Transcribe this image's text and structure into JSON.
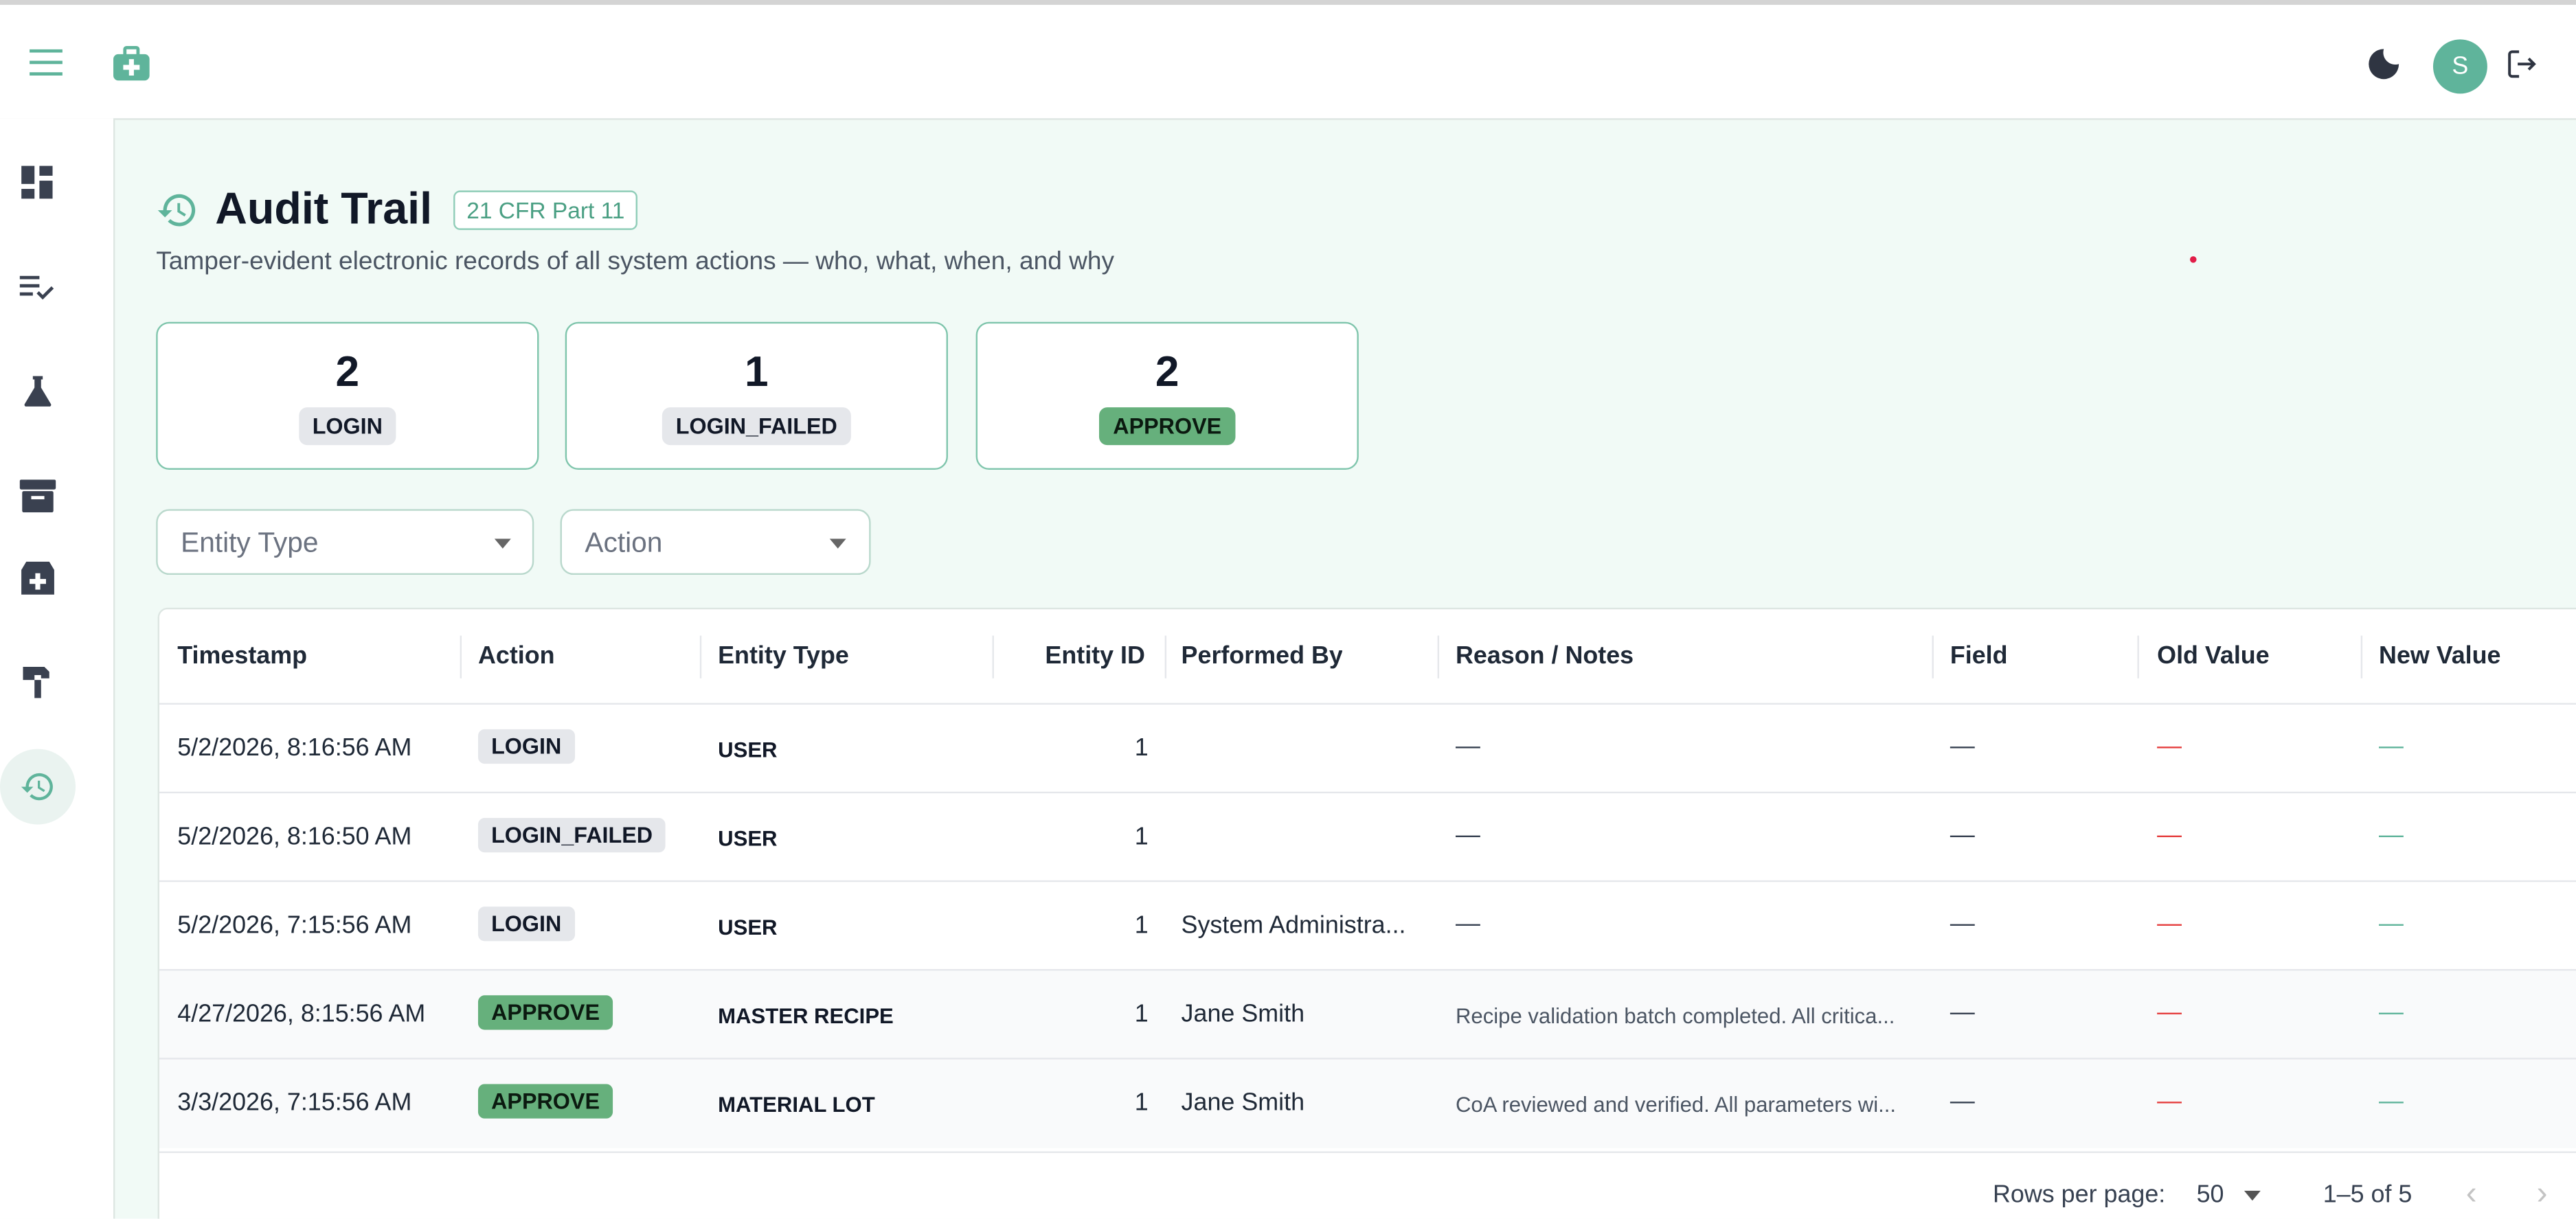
{
  "header": {
    "menu_icon": "menu-icon",
    "logo_icon": "medical-kit-icon",
    "theme_icon": "moon-icon",
    "avatar_initial": "S",
    "logout_icon": "logout-icon"
  },
  "sidebar": {
    "items": [
      {
        "icon": "dashboard-icon",
        "active": false
      },
      {
        "icon": "checklist-icon",
        "active": false
      },
      {
        "icon": "flask-icon",
        "active": false
      },
      {
        "icon": "archive-icon",
        "active": false
      },
      {
        "icon": "medical-add-icon",
        "active": false
      },
      {
        "icon": "hammer-icon",
        "active": false
      },
      {
        "icon": "history-icon",
        "active": true
      }
    ]
  },
  "page": {
    "title": "Audit Trail",
    "badge": "21 CFR Part 11",
    "subtitle": "Tamper-evident electronic records of all system actions — who, what, when, and why"
  },
  "stats": [
    {
      "value": "2",
      "label": "LOGIN",
      "style": "gray"
    },
    {
      "value": "1",
      "label": "LOGIN_FAILED",
      "style": "gray"
    },
    {
      "value": "2",
      "label": "APPROVE",
      "style": "green"
    }
  ],
  "filters": {
    "entity_type_label": "Entity Type",
    "action_label": "Action"
  },
  "table": {
    "columns": [
      "Timestamp",
      "Action",
      "Entity Type",
      "Entity ID",
      "Performed By",
      "Reason / Notes",
      "Field",
      "Old Value",
      "New Value"
    ],
    "rows": [
      {
        "timestamp": "5/2/2026, 8:16:56 AM",
        "action": "LOGIN",
        "action_style": "gray",
        "entity_type": "USER",
        "entity_id": "1",
        "performed_by": "",
        "reason": "—",
        "field": "—",
        "old_value": "—",
        "new_value": "—"
      },
      {
        "timestamp": "5/2/2026, 8:16:50 AM",
        "action": "LOGIN_FAILED",
        "action_style": "gray",
        "entity_type": "USER",
        "entity_id": "1",
        "performed_by": "",
        "reason": "—",
        "field": "—",
        "old_value": "—",
        "new_value": "—"
      },
      {
        "timestamp": "5/2/2026, 7:15:56 AM",
        "action": "LOGIN",
        "action_style": "gray",
        "entity_type": "USER",
        "entity_id": "1",
        "performed_by": "System Administra...",
        "reason": "—",
        "field": "—",
        "old_value": "—",
        "new_value": "—"
      },
      {
        "timestamp": "4/27/2026, 8:15:56 AM",
        "action": "APPROVE",
        "action_style": "green",
        "entity_type": "MASTER RECIPE",
        "entity_id": "1",
        "performed_by": "Jane Smith",
        "reason": "Recipe validation batch completed. All critica...",
        "field": "—",
        "old_value": "—",
        "new_value": "—"
      },
      {
        "timestamp": "3/3/2026, 7:15:56 AM",
        "action": "APPROVE",
        "action_style": "green",
        "entity_type": "MATERIAL LOT",
        "entity_id": "1",
        "performed_by": "Jane Smith",
        "reason": "CoA reviewed and verified. All parameters wi...",
        "field": "—",
        "old_value": "—",
        "new_value": "—"
      }
    ],
    "footer": {
      "rows_per_page_label": "Rows per page:",
      "rows_per_page_value": "50",
      "range": "1–5 of 5"
    }
  },
  "colors": {
    "accent": "#5fb49b",
    "old_value_dash": "#e53e3e",
    "new_value_dash": "#5fb49b",
    "chip_green": "#66b07c",
    "chip_gray": "#e5e7eb"
  }
}
